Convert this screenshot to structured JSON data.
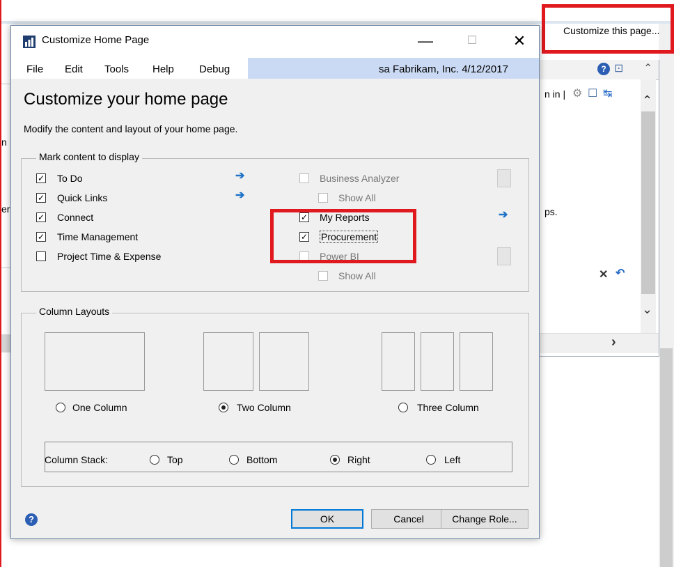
{
  "background": {
    "customize_link": "Customize this page...",
    "partial_text_1": "n in |",
    "partial_text_2": "ps.",
    "partial_left_1": "n",
    "partial_left_2": "er",
    "chevron_up": "⌃",
    "chevron_right": "›",
    "chevron_down": "⌄",
    "close_glyph": "✕",
    "undo_glyph": "↶",
    "gear_glyph": "⚙",
    "chat_glyph": "☐",
    "refresh_glyph": "↹",
    "help_glyph": "?",
    "expand_glyph": "⊡"
  },
  "dialog": {
    "title": "Customize Home Page",
    "window_controls": {
      "minimize": "—",
      "maximize": "☐",
      "close": "✕"
    },
    "menu": [
      "File",
      "Edit",
      "Tools",
      "Help",
      "Debug"
    ],
    "user_info": "sa  Fabrikam, Inc.  4/12/2017",
    "heading": "Customize your home page",
    "subheading": "Modify the content and layout of your home page.",
    "mark_content": {
      "legend": "Mark content to display",
      "left_items": [
        {
          "label": "To Do",
          "checked": true
        },
        {
          "label": "Quick Links",
          "checked": true
        },
        {
          "label": "Connect",
          "checked": true
        },
        {
          "label": "Time Management",
          "checked": true
        },
        {
          "label": "Project Time & Expense",
          "checked": false
        }
      ],
      "right_items": [
        {
          "label": "Business Analyzer",
          "checked": false,
          "disabled": true
        },
        {
          "label": "Show All",
          "checked": false,
          "disabled": true
        },
        {
          "label": "My Reports",
          "checked": true,
          "disabled": false
        },
        {
          "label": "Procurement",
          "checked": true,
          "disabled": false
        },
        {
          "label": "Power BI",
          "checked": false,
          "disabled": true
        },
        {
          "label": "Show All",
          "checked": false,
          "disabled": true
        }
      ],
      "check_glyph": "✓",
      "arrow_glyph": "➔"
    },
    "column_layouts": {
      "legend": "Column Layouts",
      "options": [
        {
          "label": "One Column",
          "selected": false
        },
        {
          "label": "Two Column",
          "selected": true
        },
        {
          "label": "Three Column",
          "selected": false
        }
      ],
      "stack_label": "Column Stack:",
      "stack_options": [
        {
          "label": "Top",
          "selected": false
        },
        {
          "label": "Bottom",
          "selected": false
        },
        {
          "label": "Right",
          "selected": true
        },
        {
          "label": "Left",
          "selected": false
        }
      ]
    },
    "help_glyph": "?",
    "buttons": {
      "ok": "OK",
      "cancel": "Cancel",
      "change_role": "Change Role..."
    }
  },
  "colors": {
    "highlight_red": "#e0191f",
    "menu_info_bg": "#cbdaf4",
    "arrow_blue": "#1e73c8"
  }
}
